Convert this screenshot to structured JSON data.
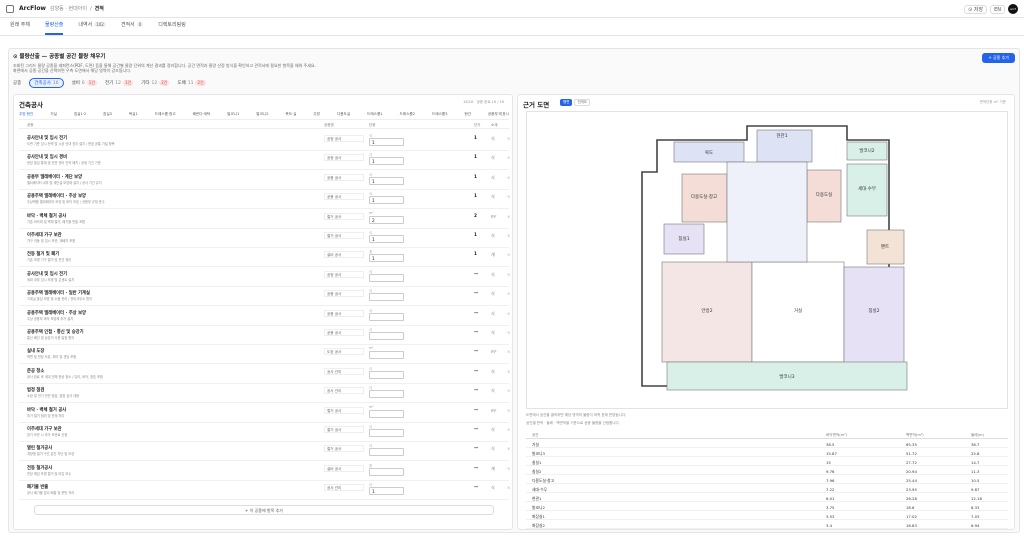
{
  "app": "ArcFlow",
  "breadcrumb": [
    "감양동 · 현대아이",
    "견적"
  ],
  "top": {
    "save": "⊙ 저장",
    "lang": "EN",
    "avatar": "arcf"
  },
  "tabs": [
    {
      "label": "원래 주체",
      "count": ""
    },
    {
      "label": "물량산출",
      "count": ""
    },
    {
      "label": "내역서",
      "count": "102"
    },
    {
      "label": "견적서",
      "count": "0"
    },
    {
      "label": "디렉토리팀링",
      "count": ""
    }
  ],
  "header": {
    "title": "⊙ 물량산출 — 공종별 공간 물량 채우기",
    "desc1": "조회된 그리드 물량 공종을 레퍼런스(PDF, 도면) 등을 통해 공간별 물량 단위의 계산 결과를 정리합니다. 공간 면적과 물량 산정 방식을 확인하고 견적서에 필요한 항목을 채워 주세요.",
    "desc2": "화면에서 공종·공간을 선택하면 우측 도면에서 해당 영역이 강조됩니다.",
    "add": "+ 공종 추가"
  },
  "chips": [
    {
      "label": "공종",
      "n": "",
      "b": ""
    },
    {
      "label": "건축공사",
      "n": "16",
      "b": ""
    },
    {
      "label": "설비",
      "n": "6",
      "b": "1건"
    },
    {
      "label": "전기",
      "n": "12",
      "b": "1건"
    },
    {
      "label": "기타",
      "n": "12",
      "b": "2건"
    },
    {
      "label": "도배",
      "n": "11",
      "b": "2건"
    }
  ],
  "left": {
    "title": "건축공사",
    "sub": "18/18 · 공종 완료 16 / 16",
    "filters": [
      "주방·현관",
      "거실",
      "침실1·2",
      "침실3",
      "욕실1",
      "드레스룸·창고",
      "베란다·세탁",
      "발코니1",
      "발코니2",
      "복도·실",
      "주방",
      "다용도실",
      "드레스룸1",
      "드레스룸2",
      "드레스룸3",
      "현관",
      "공용부·미표시"
    ],
    "cols": [
      "공종",
      "공종명",
      "단위",
      "수량",
      "단가",
      "소계"
    ],
    "rows": [
      {
        "nm": "공사안내 및 임시 전기",
        "ds": "도면 기준 임시 전력 및 시공 안내 표지 설치 / 현장 공통 가설 항목",
        "ty": "공정 공사",
        "un": "식",
        "q": "1",
        "v": "1"
      },
      {
        "nm": "공사안내 및 임시 경비",
        "ds": "현장 출입 통제 및 안전 관리 인력 배치 / 공정 기간 기준",
        "ty": "공정 공사",
        "un": "식",
        "q": "1",
        "v": "1"
      },
      {
        "nm": "공용부 엘레베이터 · 계단 보양",
        "ds": "엘리베이터 내부 및 계단실 보양재 설치 / 공사 기간 유지",
        "ty": "공용 공사",
        "un": "식",
        "q": "1",
        "v": "1"
      },
      {
        "nm": "공용주택 엘레베이터 · 주상 보양",
        "ds": "주상복합 엘리베이터 보양 및 바닥 보호 / 공용부 규정 준수",
        "ty": "공용 공사",
        "un": "식",
        "q": "1",
        "v": "1"
      },
      {
        "nm": "바닥 · 벽체 철거 공사",
        "ds": "기존 바닥재 및 벽체 철거, 폐기물 반출 포함",
        "ty": "철거 공사",
        "un": "m²",
        "q": "2",
        "v": "2"
      },
      {
        "nm": "이주세대 가구 보관",
        "ds": "가구 이동 및 임시 보관, 재배치 포함",
        "ty": "철거 공사",
        "un": "식",
        "q": "1",
        "v": "1"
      },
      {
        "nm": "전등 철거 및 폐기",
        "ds": "기존 조명 기구 철거 및 전선 정리",
        "ty": "설비 공사",
        "un": "개",
        "q": "1",
        "v": "1"
      },
      {
        "nm": "공사안내 및 임시 전기",
        "ds": "세대 내부 임시 조명 및 콘센트 설치",
        "ty": "공정 공사",
        "un": "식",
        "q": "",
        "v": "—"
      },
      {
        "nm": "공용주택 엘레베이터 · 일반 기계실",
        "ds": "기계실 출입 보양 및 소음 관리 / 관리사무소 협의",
        "ty": "공용 공사",
        "un": "식",
        "q": "",
        "v": "—"
      },
      {
        "nm": "공용주택 엘레베이터 · 주상 보양",
        "ds": "주상 공용부 바닥 보양재 추가 설치",
        "ty": "공용 공사",
        "un": "식",
        "q": "",
        "v": "—"
      },
      {
        "nm": "공용주택 인접 · 통신 및 승강기",
        "ds": "통신 배선 및 승강기 사용 일정 협의",
        "ty": "공용 공사",
        "un": "식",
        "q": "",
        "v": "—"
      },
      {
        "nm": "실내 도장",
        "ds": "벽면 및 천장 도장, 퍼티 및 샌딩 포함",
        "ty": "도장 공사",
        "un": "m²",
        "q": "",
        "v": "—"
      },
      {
        "nm": "준공 청소",
        "ds": "공사 완료 후 세대 전체 준공 청소 / 유리, 바닥, 창호 포함",
        "ty": "공사 관리",
        "un": "식",
        "q": "",
        "v": "—"
      },
      {
        "nm": "법정 점검",
        "ds": "소방 및 전기 안전 점검, 법정 검사 대응",
        "ty": "공사 관리",
        "un": "식",
        "q": "",
        "v": "—"
      },
      {
        "nm": "바닥 · 벽체 철거 공사",
        "ds": "추가 철거 범위 및 잔재 처리",
        "ty": "철거 공사",
        "un": "m²",
        "q": "",
        "v": "—"
      },
      {
        "nm": "이주세대 가구 보관",
        "ds": "장기 보관 시 추가 보관료 산정",
        "ty": "철거 공사",
        "un": "식",
        "q": "",
        "v": "—"
      },
      {
        "nm": "열린 철거공사",
        "ds": "개방형 철거 구간 분진 차단 및 보양",
        "ty": "철거 공사",
        "un": "식",
        "q": "",
        "v": "—"
      },
      {
        "nm": "전등 철거공사",
        "ds": "천장 매입 조명 철거 및 마감 보수",
        "ty": "설비 공사",
        "un": "개",
        "q": "",
        "v": "—"
      },
      {
        "nm": "폐기물 반출",
        "ds": "공사 폐기물 분리 배출 및 운반 처리",
        "ty": "공사 관리",
        "un": "식",
        "q": "1",
        "v": "—"
      }
    ],
    "more": "+ 이 공종에 항목 추가"
  },
  "right": {
    "title": "근거 도면",
    "seg": [
      "평면",
      "전개도"
    ],
    "sub": "면적단위 m² 기준",
    "rooms": {
      "r1": "현관1",
      "r2": "세대·수무",
      "r3": "다용도실·창고",
      "r4": "안방2",
      "r5": "침실1",
      "r6": "침실2",
      "r7": "거실",
      "r8": "발코니3",
      "r9": "복도",
      "r10": "다용도실",
      "r11": "팬트",
      "r12": "발코니2"
    },
    "note1": "도면에서 공간을 클릭하면 해당 영역의 물량이 좌측 표에 반영됩니다.",
    "note2": "공간별 면적 · 둘레 · 벽면적을 기준으로 공종 물량을 산정합니다.",
    "acols": [
      "공간",
      "바닥면적(m²)",
      "벽면적(m²)",
      "둘레(m)"
    ],
    "arows": [
      [
        "거실",
        "38.5",
        "65.35",
        "38.7"
      ],
      [
        "발코니3",
        "15.87",
        "51.72",
        "25.8"
      ],
      [
        "침실1",
        "15",
        "27.72",
        "14.7"
      ],
      [
        "침실2",
        "9.76",
        "20.94",
        "11.3"
      ],
      [
        "다용도실·창고",
        "7.96",
        "25.44",
        "10.5"
      ],
      [
        "세대·수무",
        "7.22",
        "23.95",
        "9.87"
      ],
      [
        "현관1",
        "6.01",
        "26.28",
        "12.18"
      ],
      [
        "발코니2",
        "3.75",
        "18.6",
        "8.33"
      ],
      [
        "화장실1",
        "3.53",
        "17.02",
        "7.03"
      ],
      [
        "화장실2",
        "3.4",
        "16.83",
        "6.94"
      ]
    ]
  }
}
